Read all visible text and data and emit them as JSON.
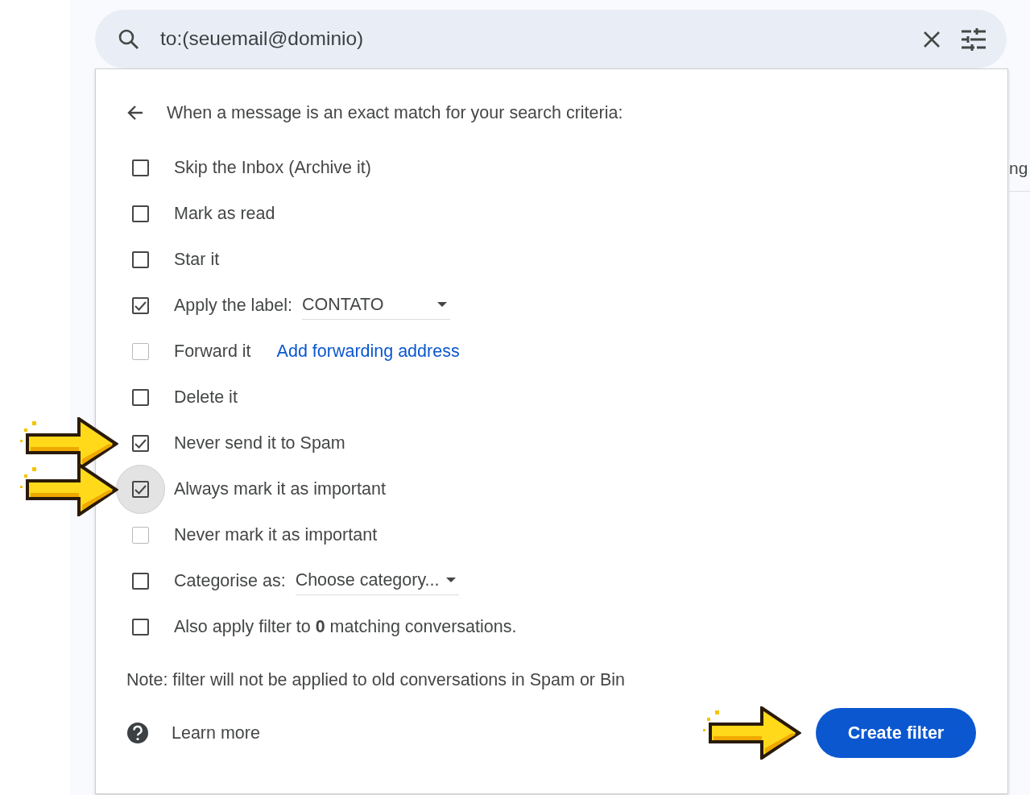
{
  "search": {
    "query": "to:(seuemail@dominio)"
  },
  "background_text": "ng",
  "filter_panel": {
    "heading": "When a message is an exact match for your search criteria:",
    "options": [
      {
        "kind": "plain",
        "label": "Skip the Inbox (Archive it)",
        "checked": false,
        "disabled": false,
        "focused": false,
        "annotated": false
      },
      {
        "kind": "plain",
        "label": "Mark as read",
        "checked": false,
        "disabled": false,
        "focused": false,
        "annotated": false
      },
      {
        "kind": "plain",
        "label": "Star it",
        "checked": false,
        "disabled": false,
        "focused": false,
        "annotated": false
      },
      {
        "kind": "select",
        "label": "Apply the label:",
        "value": "CONTATO",
        "checked": true,
        "disabled": false,
        "focused": false,
        "annotated": false
      },
      {
        "kind": "link",
        "label": "Forward it",
        "link": "Add forwarding address",
        "checked": false,
        "disabled": true,
        "focused": false,
        "annotated": false
      },
      {
        "kind": "plain",
        "label": "Delete it",
        "checked": false,
        "disabled": false,
        "focused": false,
        "annotated": false
      },
      {
        "kind": "plain",
        "label": "Never send it to Spam",
        "checked": true,
        "disabled": false,
        "focused": false,
        "annotated": true
      },
      {
        "kind": "plain",
        "label": "Always mark it as important",
        "checked": true,
        "disabled": false,
        "focused": true,
        "annotated": true
      },
      {
        "kind": "plain",
        "label": "Never mark it as important",
        "checked": false,
        "disabled": true,
        "focused": false,
        "annotated": false
      },
      {
        "kind": "select",
        "label": "Categorise as:",
        "value": "Choose category...",
        "checked": false,
        "disabled": false,
        "focused": false,
        "annotated": false
      },
      {
        "kind": "plain",
        "label": "Also apply filter to **0** matching conversations.",
        "checked": false,
        "disabled": false,
        "focused": false,
        "annotated": false
      }
    ],
    "note": "Note: filter will not be applied to old conversations in Spam or Bin",
    "learn_more": "Learn more",
    "create_button": {
      "label": "Create filter",
      "annotated": true
    }
  }
}
